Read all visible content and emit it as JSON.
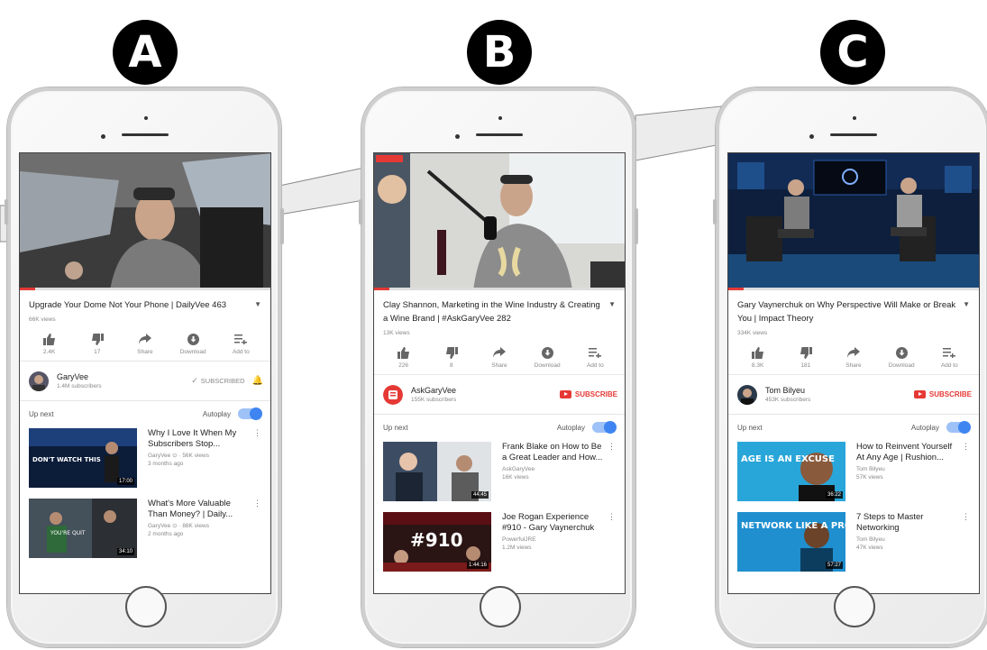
{
  "labels": [
    "A",
    "B",
    "C"
  ],
  "phones": [
    {
      "video_title": "Upgrade Your Dome Not Your Phone | DailyVee 463",
      "views": "66K views",
      "actions": {
        "like": "2.4K",
        "dislike": "17",
        "share": "Share",
        "download": "Download",
        "add": "Add to"
      },
      "channel_name": "GaryVee",
      "channel_subs": "1.4M subscribers",
      "sub_label": "SUBSCRIBED",
      "up_next": "Up next",
      "autoplay": "Autoplay",
      "items": [
        {
          "title": "Why I Love It When My Subscribers Stop...",
          "channel": "GaryVee ⊙ · 56K views",
          "meta": "3 months ago",
          "duration": "17:00"
        },
        {
          "title": "What's More Valuable Than Money? | Daily...",
          "channel": "GaryVee ⊙ · 88K views",
          "meta": "2 months ago",
          "duration": "34:10"
        }
      ]
    },
    {
      "video_title": "Clay Shannon, Marketing in the Wine Industry & Creating a Wine Brand | #AskGaryVee 282",
      "views": "13K views",
      "actions": {
        "like": "226",
        "dislike": "8",
        "share": "Share",
        "download": "Download",
        "add": "Add to"
      },
      "channel_name": "AskGaryVee",
      "channel_subs": "155K subscribers",
      "sub_label": "SUBSCRIBE",
      "up_next": "Up next",
      "autoplay": "Autoplay",
      "items": [
        {
          "title": "Frank Blake on How to Be a Great Leader and How...",
          "channel": "AskGaryVee",
          "meta": "16K views",
          "duration": "44:45"
        },
        {
          "title": "Joe Rogan Experience #910 - Gary Vaynerchuk",
          "channel": "PowerfulJRE",
          "meta": "1.2M views",
          "duration": "1:44:16"
        }
      ]
    },
    {
      "video_title": "Gary Vaynerchuk on Why Perspective Will Make or Break You | Impact Theory",
      "views": "334K views",
      "actions": {
        "like": "8.3K",
        "dislike": "181",
        "share": "Share",
        "download": "Download",
        "add": "Add to"
      },
      "channel_name": "Tom Bilyeu",
      "channel_subs": "453K subscribers",
      "sub_label": "SUBSCRIBE",
      "up_next": "Up next",
      "autoplay": "Autoplay",
      "items": [
        {
          "title": "How to Reinvent Yourself At Any Age | Rushion...",
          "channel": "Tom Bilyeu",
          "meta": "57K views",
          "duration": "36:22"
        },
        {
          "title": "7 Steps to Master Networking",
          "channel": "Tom Bilyeu",
          "meta": "47K views",
          "duration": "57:27"
        }
      ]
    }
  ],
  "thumb_text": {
    "a1": "DON'T WATCH THIS",
    "a2": "YOU'RE QUIT",
    "b2": "#910",
    "c1": "AGE IS AN EXCUSE",
    "c2": "NETWORK LIKE A PRO"
  },
  "icons": [
    "thumbs-up",
    "thumbs-down",
    "share",
    "download",
    "add-to-playlist",
    "bell",
    "checkmark",
    "youtube-logo",
    "kebab-menu"
  ],
  "colors": {
    "accent_red": "#e53935",
    "toggle_blue": "#3f85f2"
  }
}
